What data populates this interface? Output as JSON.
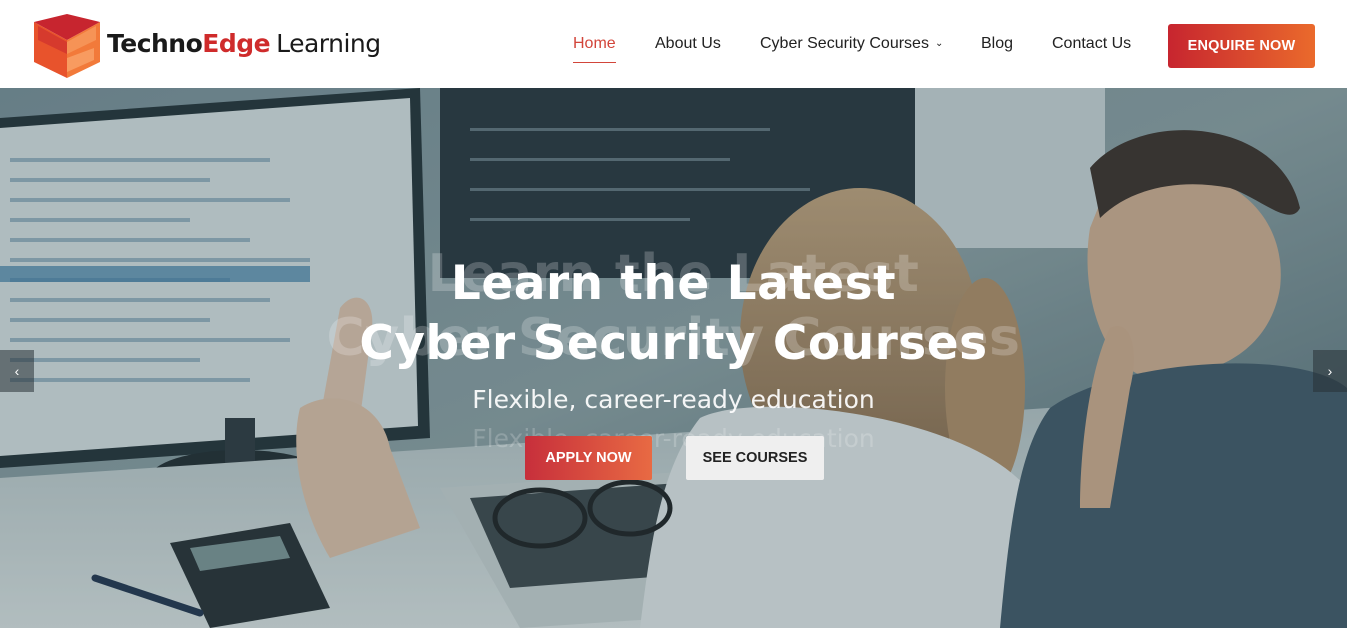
{
  "brand": {
    "name_part1": "Techno",
    "name_part2": "Edge",
    "name_part3": "Learning",
    "colors": {
      "primary": "#cf2b2b",
      "accent_orange": "#ea6a2c"
    }
  },
  "nav": {
    "items": [
      {
        "label": "Home",
        "active": true
      },
      {
        "label": "About Us",
        "active": false
      },
      {
        "label": "Cyber Security Courses",
        "active": false,
        "has_dropdown": true
      },
      {
        "label": "Blog",
        "active": false
      },
      {
        "label": "Contact Us",
        "active": false
      }
    ],
    "cta_label": "ENQUIRE NOW"
  },
  "hero": {
    "headline_line1": "Learn the Latest",
    "headline_line2": "Cyber Security Courses",
    "subheading": "Flexible, career-ready education",
    "ghost_subheading": "Flexible, career-ready education",
    "primary_button": "APPLY NOW",
    "secondary_button": "SEE COURSES",
    "prev_icon": "chevron-left-icon",
    "next_icon": "chevron-right-icon"
  }
}
